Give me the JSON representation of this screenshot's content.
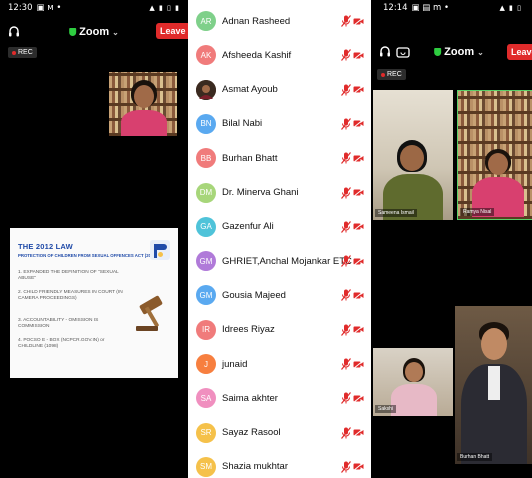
{
  "colors": {
    "leave_red": "#e02b2b",
    "shield_green": "#2ecc40",
    "muted_red": "#e02b2b",
    "slide_blue": "#1f4aa8"
  },
  "left_phone": {
    "status_time": "12:30",
    "status_extra": "▣ ᴍ •",
    "status_icons": "▲ ▮ ▯ ▮",
    "meeting_title": "Zoom",
    "leave_label": "Leave",
    "rec_label": "REC",
    "slide": {
      "title": "THE 2012 LAW",
      "subtitle": "PROTECTION OF CHILDREN FROM SEXUAL OFFENCES ACT (2012)",
      "logo_text": "BHASHIN PROJECT",
      "points": [
        "1. EXPANDED THE DEFINITION OF \"SEXUAL ABUSE\"",
        "2. CHILD FRIENDLY MEASURES IN COURT (IN CAMERA PROCEEDINGS)",
        "3. ACCOUNTABILITY - OMISSION IS COMMISSION",
        "4. POCSO E - BOX (NCPCR.GOV.IN) or CHILDLINE (1098)"
      ]
    }
  },
  "participants": [
    {
      "initials": "AR",
      "name": "Adnan Rasheed",
      "color": "#7fd08a",
      "photo": false
    },
    {
      "initials": "AK",
      "name": "Afsheeda Kashif",
      "color": "#f07b7b",
      "photo": false
    },
    {
      "initials": "",
      "name": "Asmat Ayoub",
      "color": "#6a3a2a",
      "photo": true
    },
    {
      "initials": "BN",
      "name": "Bilal Nabi",
      "color": "#5aa9f0",
      "photo": false
    },
    {
      "initials": "BB",
      "name": "Burhan Bhatt",
      "color": "#f07b7b",
      "photo": false
    },
    {
      "initials": "DM",
      "name": "Dr. Minerva Ghani",
      "color": "#a7d67a",
      "photo": false
    },
    {
      "initials": "GA",
      "name": "Gazenfur Ali",
      "color": "#4fc3d9",
      "photo": false
    },
    {
      "initials": "GM",
      "name": "GHRIET,Anchal Mojankar ETC",
      "color": "#b07ad9",
      "photo": false
    },
    {
      "initials": "GM",
      "name": "Gousia Majeed",
      "color": "#5aa9f0",
      "photo": false
    },
    {
      "initials": "IR",
      "name": "Idrees Riyaz",
      "color": "#f07b7b",
      "photo": false
    },
    {
      "initials": "J",
      "name": "junaid",
      "color": "#f77f3f",
      "photo": false
    },
    {
      "initials": "SA",
      "name": "Saima akhter",
      "color": "#f08fbf",
      "photo": false
    },
    {
      "initials": "SR",
      "name": "Sayaz Rasool",
      "color": "#f5c14a",
      "photo": false
    },
    {
      "initials": "SM",
      "name": "Shazia mukhtar",
      "color": "#f5c14a",
      "photo": false
    }
  ],
  "right_phone": {
    "status_time": "12:14",
    "status_extra": "▣ ▤ m •",
    "status_icons": "▲ ▮ ▯",
    "meeting_title": "Zoom",
    "leave_label": "Leave",
    "rec_label": "REC",
    "tiles": [
      {
        "label": "Sameena Ismail"
      },
      {
        "label": "Ramya Nisal"
      },
      {
        "label": "Sakshi"
      },
      {
        "label": "Burhan Bhatt"
      }
    ]
  }
}
